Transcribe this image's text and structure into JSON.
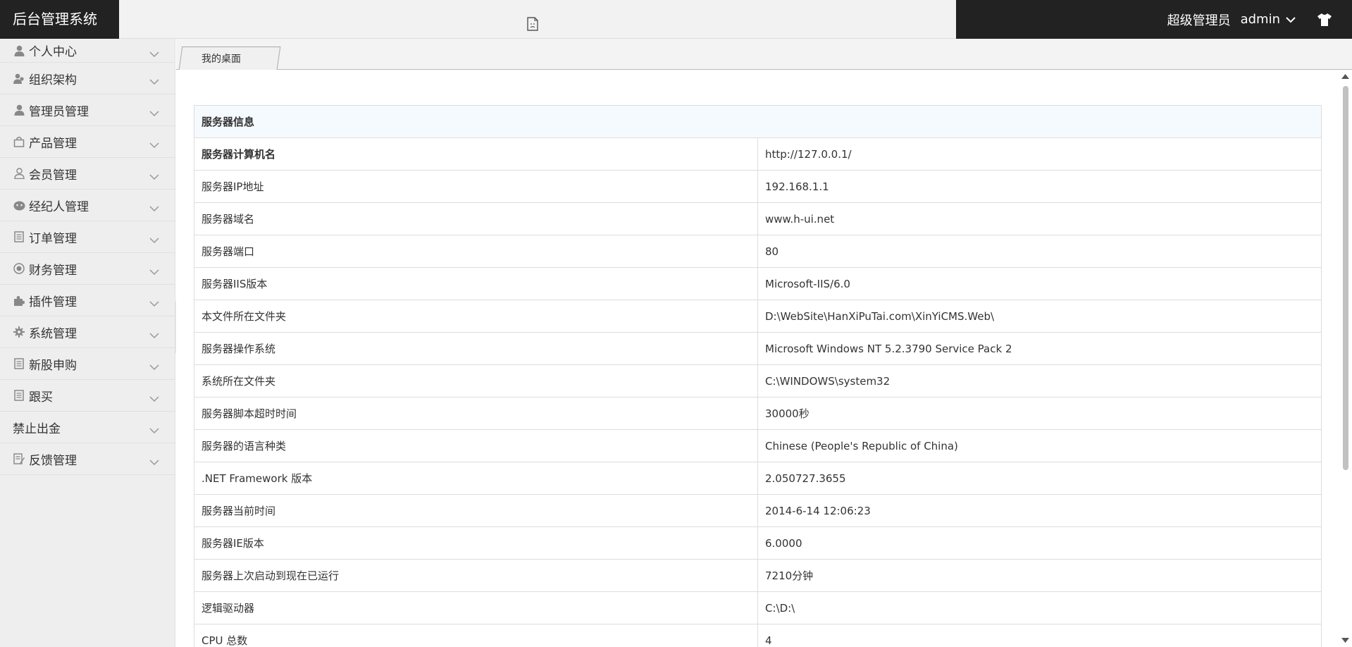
{
  "header": {
    "logo": "后台管理系统",
    "role": "超级管理员",
    "username": "admin"
  },
  "sidebar": {
    "items": [
      {
        "label": "个人中心",
        "icon": "user-icon"
      },
      {
        "label": "组织架构",
        "icon": "users-icon"
      },
      {
        "label": "管理员管理",
        "icon": "user-icon"
      },
      {
        "label": "产品管理",
        "icon": "bag-icon"
      },
      {
        "label": "会员管理",
        "icon": "user-outline-icon"
      },
      {
        "label": "经纪人管理",
        "icon": "group-icon"
      },
      {
        "label": "订单管理",
        "icon": "document-icon"
      },
      {
        "label": "财务管理",
        "icon": "target-icon"
      },
      {
        "label": "插件管理",
        "icon": "puzzle-icon"
      },
      {
        "label": "系统管理",
        "icon": "gear-icon"
      },
      {
        "label": "新股申购",
        "icon": "document-icon"
      },
      {
        "label": "跟买",
        "icon": "document-icon"
      },
      {
        "label": "禁止出金",
        "icon": ""
      },
      {
        "label": "反馈管理",
        "icon": "feedback-icon"
      }
    ]
  },
  "tabs": [
    {
      "label": "我的桌面"
    }
  ],
  "server_info": {
    "title": "服务器信息",
    "rows": [
      {
        "key": "服务器计算机名",
        "value": "http://127.0.0.1/"
      },
      {
        "key": "服务器IP地址",
        "value": "192.168.1.1"
      },
      {
        "key": "服务器域名",
        "value": "www.h-ui.net"
      },
      {
        "key": "服务器端口",
        "value": "80"
      },
      {
        "key": "服务器IIS版本",
        "value": "Microsoft-IIS/6.0"
      },
      {
        "key": "本文件所在文件夹",
        "value": "D:\\WebSite\\HanXiPuTai.com\\XinYiCMS.Web\\"
      },
      {
        "key": "服务器操作系统",
        "value": "Microsoft Windows NT 5.2.3790 Service Pack 2"
      },
      {
        "key": "系统所在文件夹",
        "value": "C:\\WINDOWS\\system32"
      },
      {
        "key": "服务器脚本超时时间",
        "value": "30000秒"
      },
      {
        "key": "服务器的语言种类",
        "value": "Chinese (People's Republic of China)"
      },
      {
        "key": ".NET Framework 版本",
        "value": "2.050727.3655"
      },
      {
        "key": "服务器当前时间",
        "value": "2014-6-14 12:06:23"
      },
      {
        "key": "服务器IE版本",
        "value": "6.0000"
      },
      {
        "key": "服务器上次启动到现在已运行",
        "value": "7210分钟"
      },
      {
        "key": "逻辑驱动器",
        "value": "C:\\D:\\"
      },
      {
        "key": "CPU 总数",
        "value": "4"
      }
    ]
  },
  "colors": {
    "header_bg": "#222222",
    "sidebar_bg": "#eeeeee",
    "table_header_bg": "#f5fafe"
  }
}
